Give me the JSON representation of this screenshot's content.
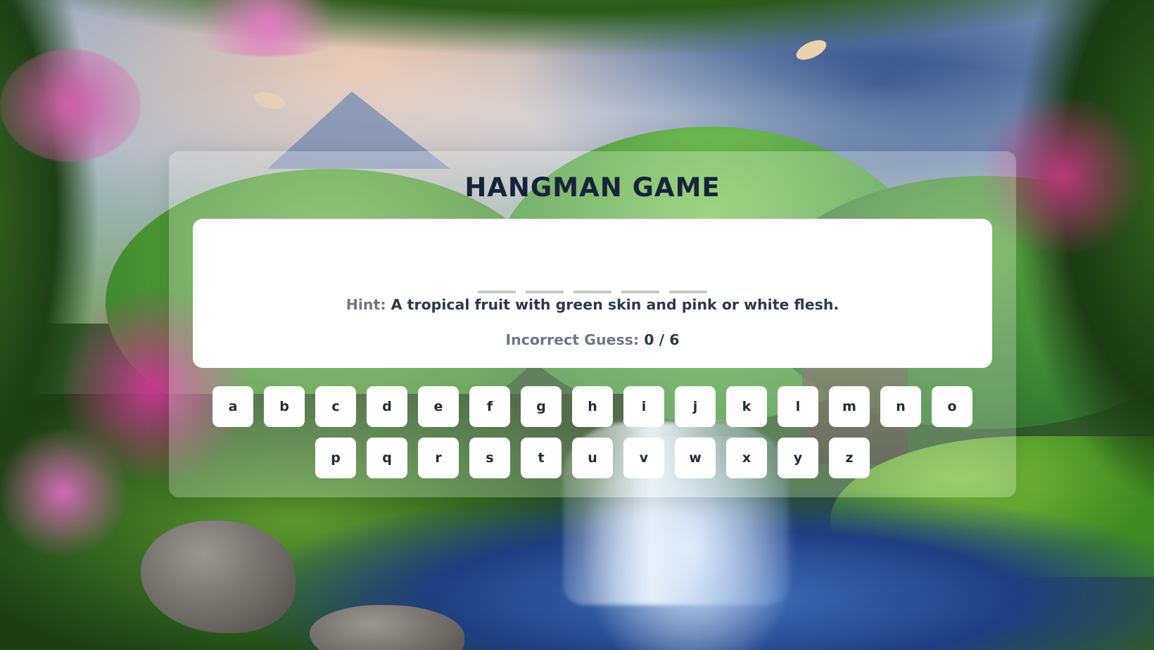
{
  "game": {
    "title": "HANGMAN GAME",
    "word_slots": [
      "",
      "",
      "",
      "",
      ""
    ],
    "hint_label": "Hint:",
    "hint_text": "A tropical fruit with green skin and pink or white flesh.",
    "guess_label": "Incorrect Guess:",
    "guess_value": "0 / 6"
  },
  "keyboard": {
    "rows": [
      [
        "a",
        "b",
        "c",
        "d",
        "e",
        "f",
        "g",
        "h",
        "i",
        "j",
        "k",
        "l",
        "m",
        "n",
        "o"
      ],
      [
        "p",
        "q",
        "r",
        "s",
        "t",
        "u",
        "v",
        "w",
        "x",
        "y",
        "z"
      ]
    ]
  },
  "colors": {
    "title": "#15243a",
    "card_bg": "rgba(255,255,255,0.24)",
    "panel_bg": "#ffffff",
    "slot_line": "#c7c7c7",
    "label_gray": "#6e7784",
    "text_dark": "#2e3948",
    "key_bg": "#ffffff"
  },
  "background": {
    "scene": "fantasy forest with waterfall, flowering trees, river and mountains"
  }
}
